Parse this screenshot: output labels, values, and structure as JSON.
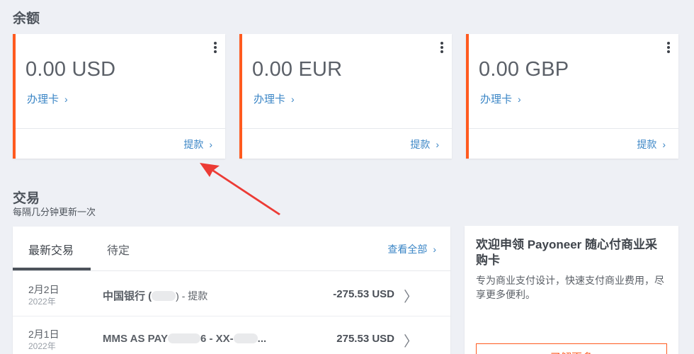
{
  "balances": {
    "title": "余额",
    "card_link_label": "办理卡",
    "withdraw_label": "提款",
    "cards": [
      {
        "amount": "0.00 USD"
      },
      {
        "amount": "0.00 EUR"
      },
      {
        "amount": "0.00 GBP"
      }
    ]
  },
  "transactions": {
    "title": "交易",
    "subtitle": "每隔几分钟更新一次",
    "tabs": [
      {
        "label": "最新交易",
        "active": true
      },
      {
        "label": "待定",
        "active": false
      }
    ],
    "view_all_label": "查看全部",
    "rows": [
      {
        "date": "2月2日",
        "year": "2022年",
        "desc_prefix": "中国银行 (",
        "desc_suffix": ") - 提款",
        "amount": "-275.53 USD"
      },
      {
        "date": "2月1日",
        "year": "2022年",
        "desc_prefix": "MMS AS PAY",
        "desc_mid": "6 - XX-",
        "desc_end": "...",
        "amount": "275.53 USD"
      }
    ]
  },
  "promo": {
    "title": "欢迎申领 Payoneer 随心付商业采购卡",
    "description": "专为商业支付设计，快速支付商业费用，尽享更多便利。",
    "button_label": "了解更多"
  },
  "colors": {
    "accent": "#ff5a1f",
    "link": "#3b86c6",
    "background": "#eef0f5"
  }
}
